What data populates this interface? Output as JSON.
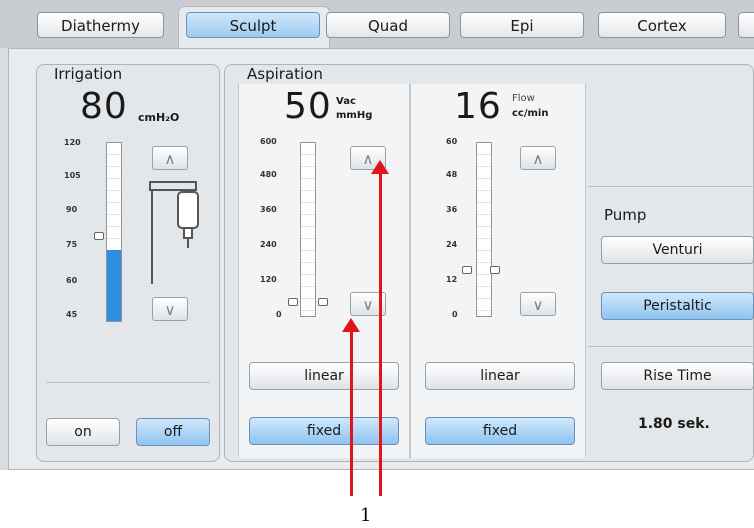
{
  "tabs": [
    {
      "label": "Diathermy",
      "active": false
    },
    {
      "label": "Sculpt",
      "active": true
    },
    {
      "label": "Quad",
      "active": false
    },
    {
      "label": "Epi",
      "active": false
    },
    {
      "label": "Cortex",
      "active": false
    }
  ],
  "irrigation": {
    "title": "Irrigation",
    "value": "80",
    "unit": "cmH₂O",
    "ticks": [
      "120",
      "105",
      "90",
      "75",
      "60",
      "45"
    ],
    "level": 75,
    "up_icon": "chevron-up-icon",
    "down_icon": "chevron-down-icon",
    "on_label": "on",
    "off_label": "off",
    "off_active": true
  },
  "aspiration": {
    "title": "Aspiration",
    "vac": {
      "value": "50",
      "unit_line1": "Vac",
      "unit_line2": "mmHg",
      "ticks": [
        "600",
        "480",
        "360",
        "240",
        "120",
        "0"
      ],
      "linear_label": "linear",
      "fixed_label": "fixed"
    },
    "flow": {
      "value": "16",
      "unit_line1": "Flow",
      "unit_line2": "cc/min",
      "ticks": [
        "60",
        "48",
        "36",
        "24",
        "12",
        "0"
      ],
      "linear_label": "linear",
      "fixed_label": "fixed"
    }
  },
  "pump": {
    "title": "Pump",
    "venturi_label": "Venturi",
    "peristaltic_label": "Peristaltic",
    "active": "Peristaltic",
    "rise_time_label": "Rise Time",
    "rise_time_value": "1.80 sek."
  },
  "annotation": {
    "label": "1",
    "color": "#e0141b"
  },
  "colors": {
    "accent_blue": "#2f8ee0",
    "button_blue": "#9ccbf0"
  }
}
